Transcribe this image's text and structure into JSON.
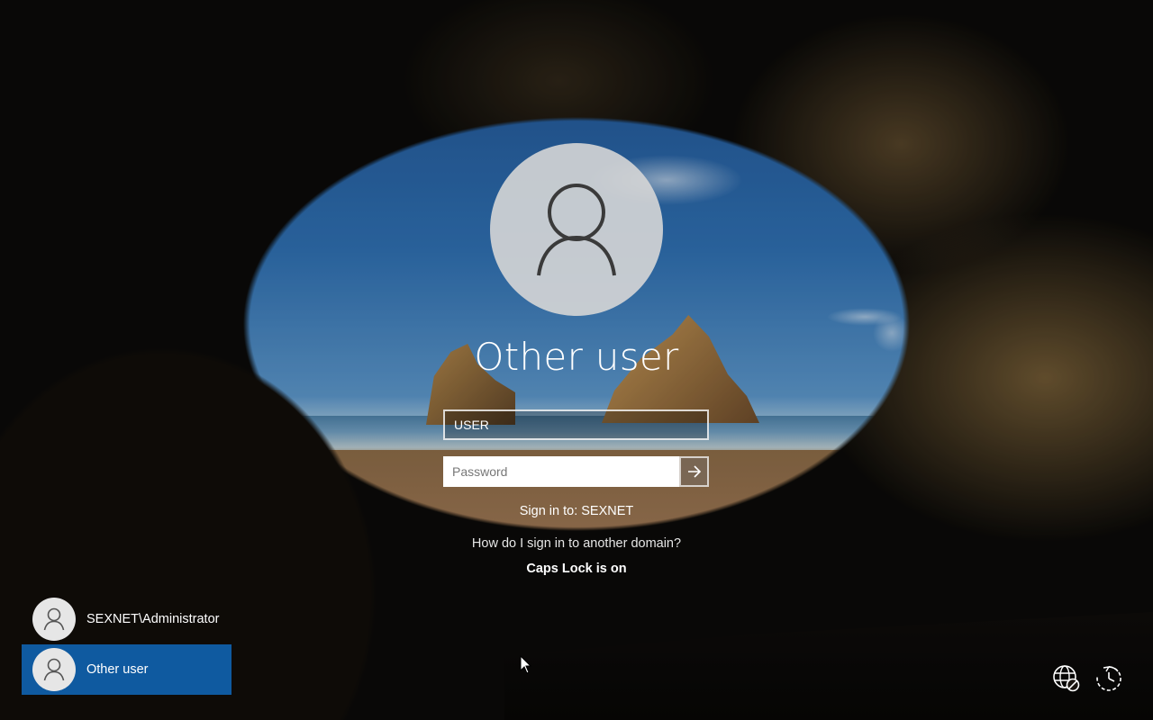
{
  "login": {
    "display_name": "Other user",
    "username_value": "USER",
    "password_placeholder": "Password",
    "sign_in_to": "Sign in to: SEXNET",
    "other_domain_link": "How do I sign in to another domain?",
    "caps_lock_warning": "Caps Lock is on"
  },
  "user_list": [
    {
      "label": "SEXNET\\Administrator",
      "selected": false
    },
    {
      "label": "Other user",
      "selected": true
    }
  ],
  "icons": {
    "avatar": "user-silhouette-icon",
    "submit": "arrow-right-icon",
    "network": "network-disconnected-icon",
    "accessibility": "ease-of-access-icon"
  },
  "colors": {
    "selected_tile": "#0f5aa0"
  }
}
